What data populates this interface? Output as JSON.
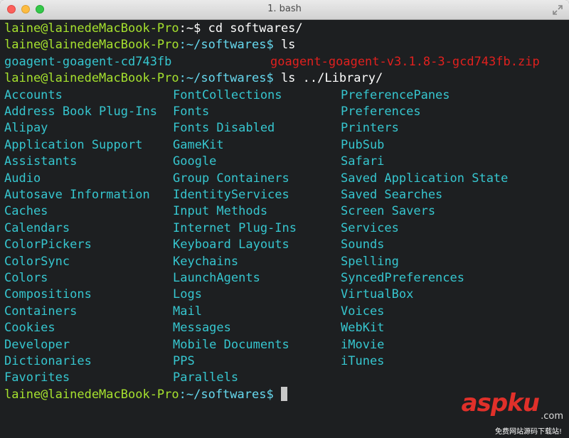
{
  "window": {
    "title": "1. bash"
  },
  "prompt": {
    "user": "laine@lainedeMacBook-Pro"
  },
  "session": {
    "line1": {
      "path": ":~$ ",
      "command": "cd softwares/"
    },
    "line2": {
      "path": ":~/softwares$ ",
      "command": "ls"
    },
    "ls_output": {
      "dir": "goagent-goagent-cd743fb",
      "zip": "goagent-goagent-v3.1.8-3-gcd743fb.zip"
    },
    "line4": {
      "path": ":~/softwares$ ",
      "command": "ls ../Library/"
    },
    "library_columns": [
      [
        "Accounts",
        "Address Book Plug-Ins",
        "Alipay",
        "Application Support",
        "Assistants",
        "Audio",
        "Autosave Information",
        "Caches",
        "Calendars",
        "ColorPickers",
        "ColorSync",
        "Colors",
        "Compositions",
        "Containers",
        "Cookies",
        "Developer",
        "Dictionaries",
        "Favorites"
      ],
      [
        "FontCollections",
        "Fonts",
        "Fonts Disabled",
        "GameKit",
        "Google",
        "Group Containers",
        "IdentityServices",
        "Input Methods",
        "Internet Plug-Ins",
        "Keyboard Layouts",
        "Keychains",
        "LaunchAgents",
        "Logs",
        "Mail",
        "Messages",
        "Mobile Documents",
        "PPS",
        "Parallels"
      ],
      [
        "PreferencePanes",
        "Preferences",
        "Printers",
        "PubSub",
        "Safari",
        "Saved Application State",
        "Saved Searches",
        "Screen Savers",
        "Services",
        "Sounds",
        "Spelling",
        "SyncedPreferences",
        "VirtualBox",
        "Voices",
        "WebKit",
        "iMovie",
        "iTunes"
      ]
    ],
    "final_prompt": {
      "path": ":~/softwares$ "
    }
  },
  "watermark": {
    "main": "aspku",
    "suffix": ".com",
    "subtitle": "免费网站源码下载站!"
  },
  "colors": {
    "background": "#1d1f21",
    "user": "#a6e22e",
    "path": "#66d9ef",
    "directory": "#36c6cf",
    "archive": "#e0201e"
  },
  "icons": {
    "close": "close-dot",
    "minimize": "minimize-dot",
    "zoom": "zoom-dot",
    "fullscreen": "fullscreen-arrows-icon"
  }
}
